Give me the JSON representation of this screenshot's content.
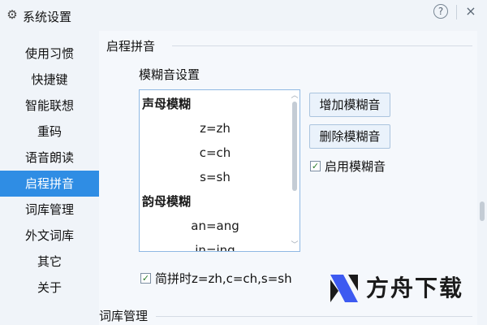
{
  "window": {
    "title": "系统设置",
    "help_label": "?",
    "close_label": "×"
  },
  "sidebar": {
    "active_index": 5,
    "items": [
      {
        "label": "使用习惯"
      },
      {
        "label": "快捷键"
      },
      {
        "label": "智能联想"
      },
      {
        "label": "重码"
      },
      {
        "label": "语音朗读"
      },
      {
        "label": "启程拼音"
      },
      {
        "label": "词库管理"
      },
      {
        "label": "外文词库"
      },
      {
        "label": "其它"
      },
      {
        "label": "关于"
      }
    ]
  },
  "main": {
    "section_title": "启程拼音",
    "fuzzy_title": "模糊音设置",
    "fuzzy_list": [
      {
        "text": "声母模糊",
        "kind": "header"
      },
      {
        "text": "z=zh",
        "kind": "entry"
      },
      {
        "text": "c=ch",
        "kind": "entry"
      },
      {
        "text": "s=sh",
        "kind": "entry"
      },
      {
        "text": "韵母模糊",
        "kind": "header"
      },
      {
        "text": "an=ang",
        "kind": "entry"
      },
      {
        "text": "in=ing",
        "kind": "entry"
      }
    ],
    "add_button": "增加模糊音",
    "delete_button": "删除模糊音",
    "enable_fuzzy": {
      "label": "启用模糊音",
      "checked": true
    },
    "abbrev_option": {
      "label": "简拼时z=zh,c=ch,s=sh",
      "checked": true
    },
    "next_section_title": "词库管理"
  },
  "watermark": {
    "text": "方舟下载",
    "colors": {
      "blue": "#3d5af1",
      "dark": "#1b1b1b"
    }
  },
  "colors": {
    "accent": "#2f8de4",
    "check": "#2a7a2a"
  }
}
